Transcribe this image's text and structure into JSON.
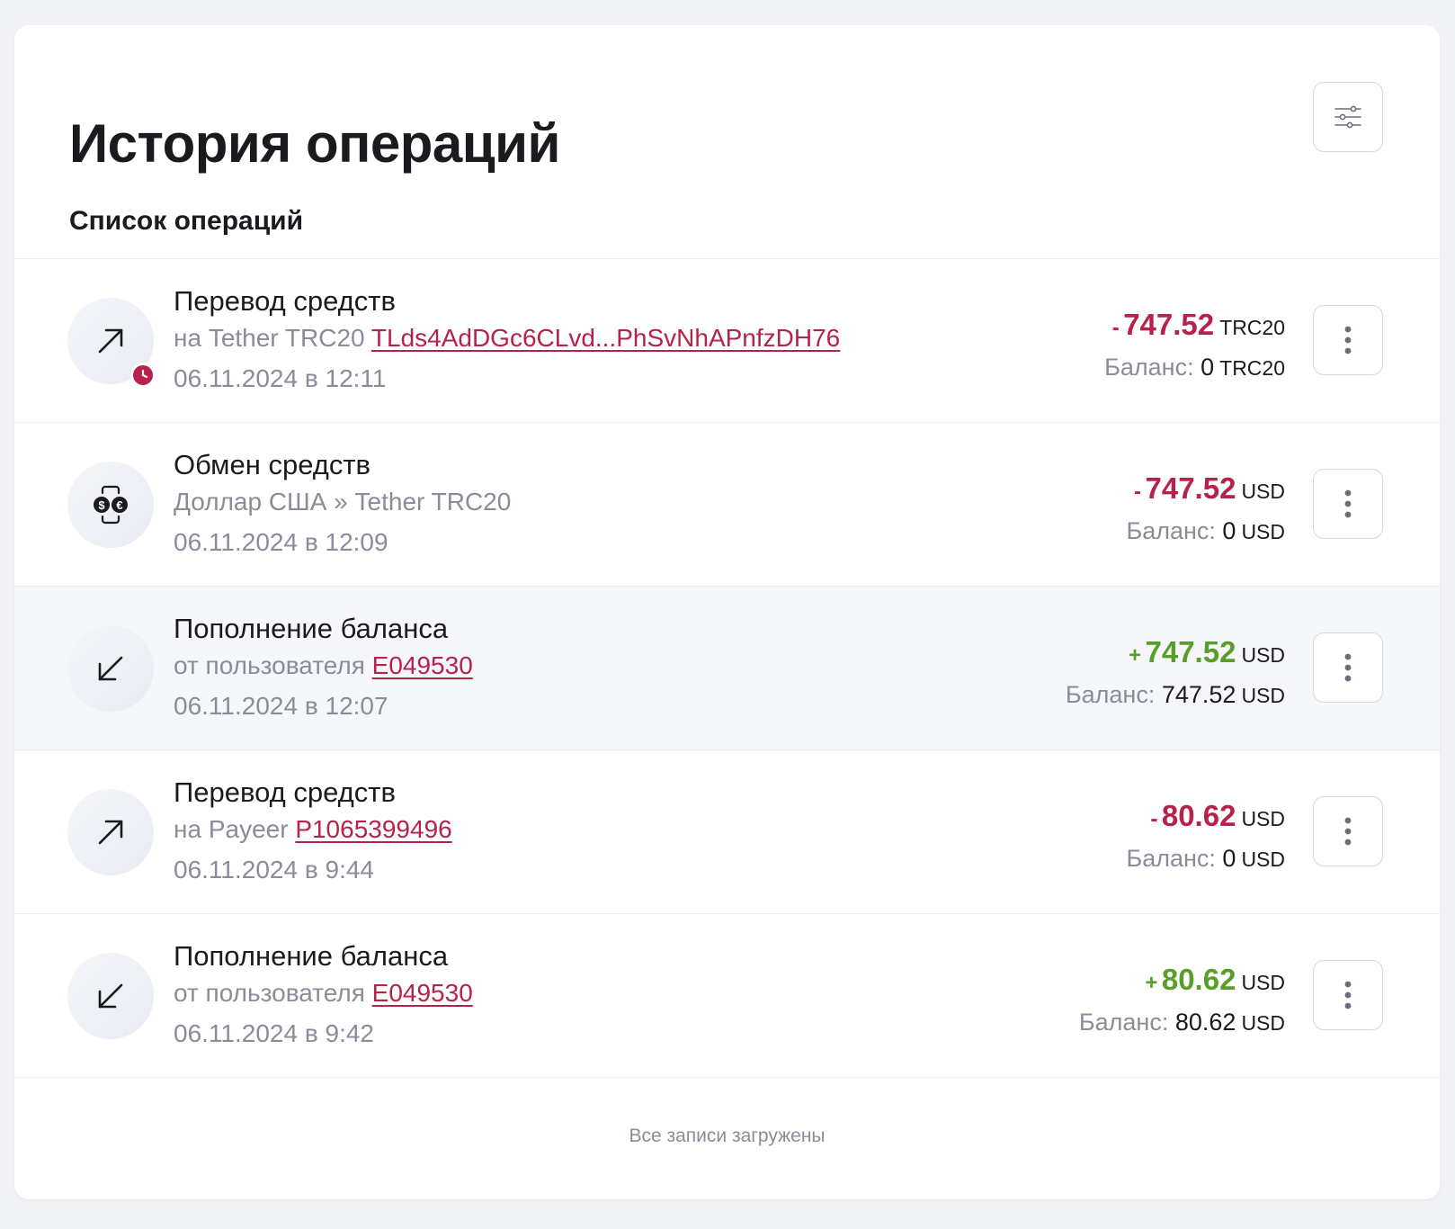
{
  "header": {
    "title": "История операций",
    "filter_icon": "sliders-icon",
    "section_title": "Список операций"
  },
  "operations": [
    {
      "icon": "arrow-up-right-icon",
      "pending": true,
      "title": "Перевод средств",
      "subtitle_prefix": "на Tether TRC20",
      "subtitle_link": "TLds4AdDGc6CLvd...PhSvNhAPnfzDH76",
      "date": "06.11.2024 в 12:11",
      "sign": "-",
      "amount": "747.52",
      "currency": "TRC20",
      "balance_label": "Баланс:",
      "balance_value": "0",
      "balance_currency": "TRC20"
    },
    {
      "icon": "currency-exchange-icon",
      "title": "Обмен средств",
      "subtitle_prefix": "Доллар США » Tether TRC20",
      "date": "06.11.2024 в 12:09",
      "sign": "-",
      "amount": "747.52",
      "currency": "USD",
      "balance_label": "Баланс:",
      "balance_value": "0",
      "balance_currency": "USD"
    },
    {
      "icon": "arrow-down-left-icon",
      "title": "Пополнение баланса",
      "subtitle_prefix": "от пользователя",
      "subtitle_link": "E049530",
      "date": "06.11.2024 в 12:07",
      "sign": "+",
      "amount": "747.52",
      "currency": "USD",
      "balance_label": "Баланс:",
      "balance_value": "747.52",
      "balance_currency": "USD"
    },
    {
      "icon": "arrow-up-right-icon",
      "title": "Перевод средств",
      "subtitle_prefix": "на Payeer",
      "subtitle_link": "P1065399496",
      "date": "06.11.2024 в 9:44",
      "sign": "-",
      "amount": "80.62",
      "currency": "USD",
      "balance_label": "Баланс:",
      "balance_value": "0",
      "balance_currency": "USD"
    },
    {
      "icon": "arrow-down-left-icon",
      "title": "Пополнение баланса",
      "subtitle_prefix": "от пользователя",
      "subtitle_link": "E049530",
      "date": "06.11.2024 в 9:42",
      "sign": "+",
      "amount": "80.62",
      "currency": "USD",
      "balance_label": "Баланс:",
      "balance_value": "80.62",
      "balance_currency": "USD"
    }
  ],
  "footer": {
    "text": "Все записи загружены"
  },
  "colors": {
    "negative": "#b5234c",
    "positive": "#5a9e2a",
    "muted": "#8a8d99",
    "link": "#b5234c"
  }
}
